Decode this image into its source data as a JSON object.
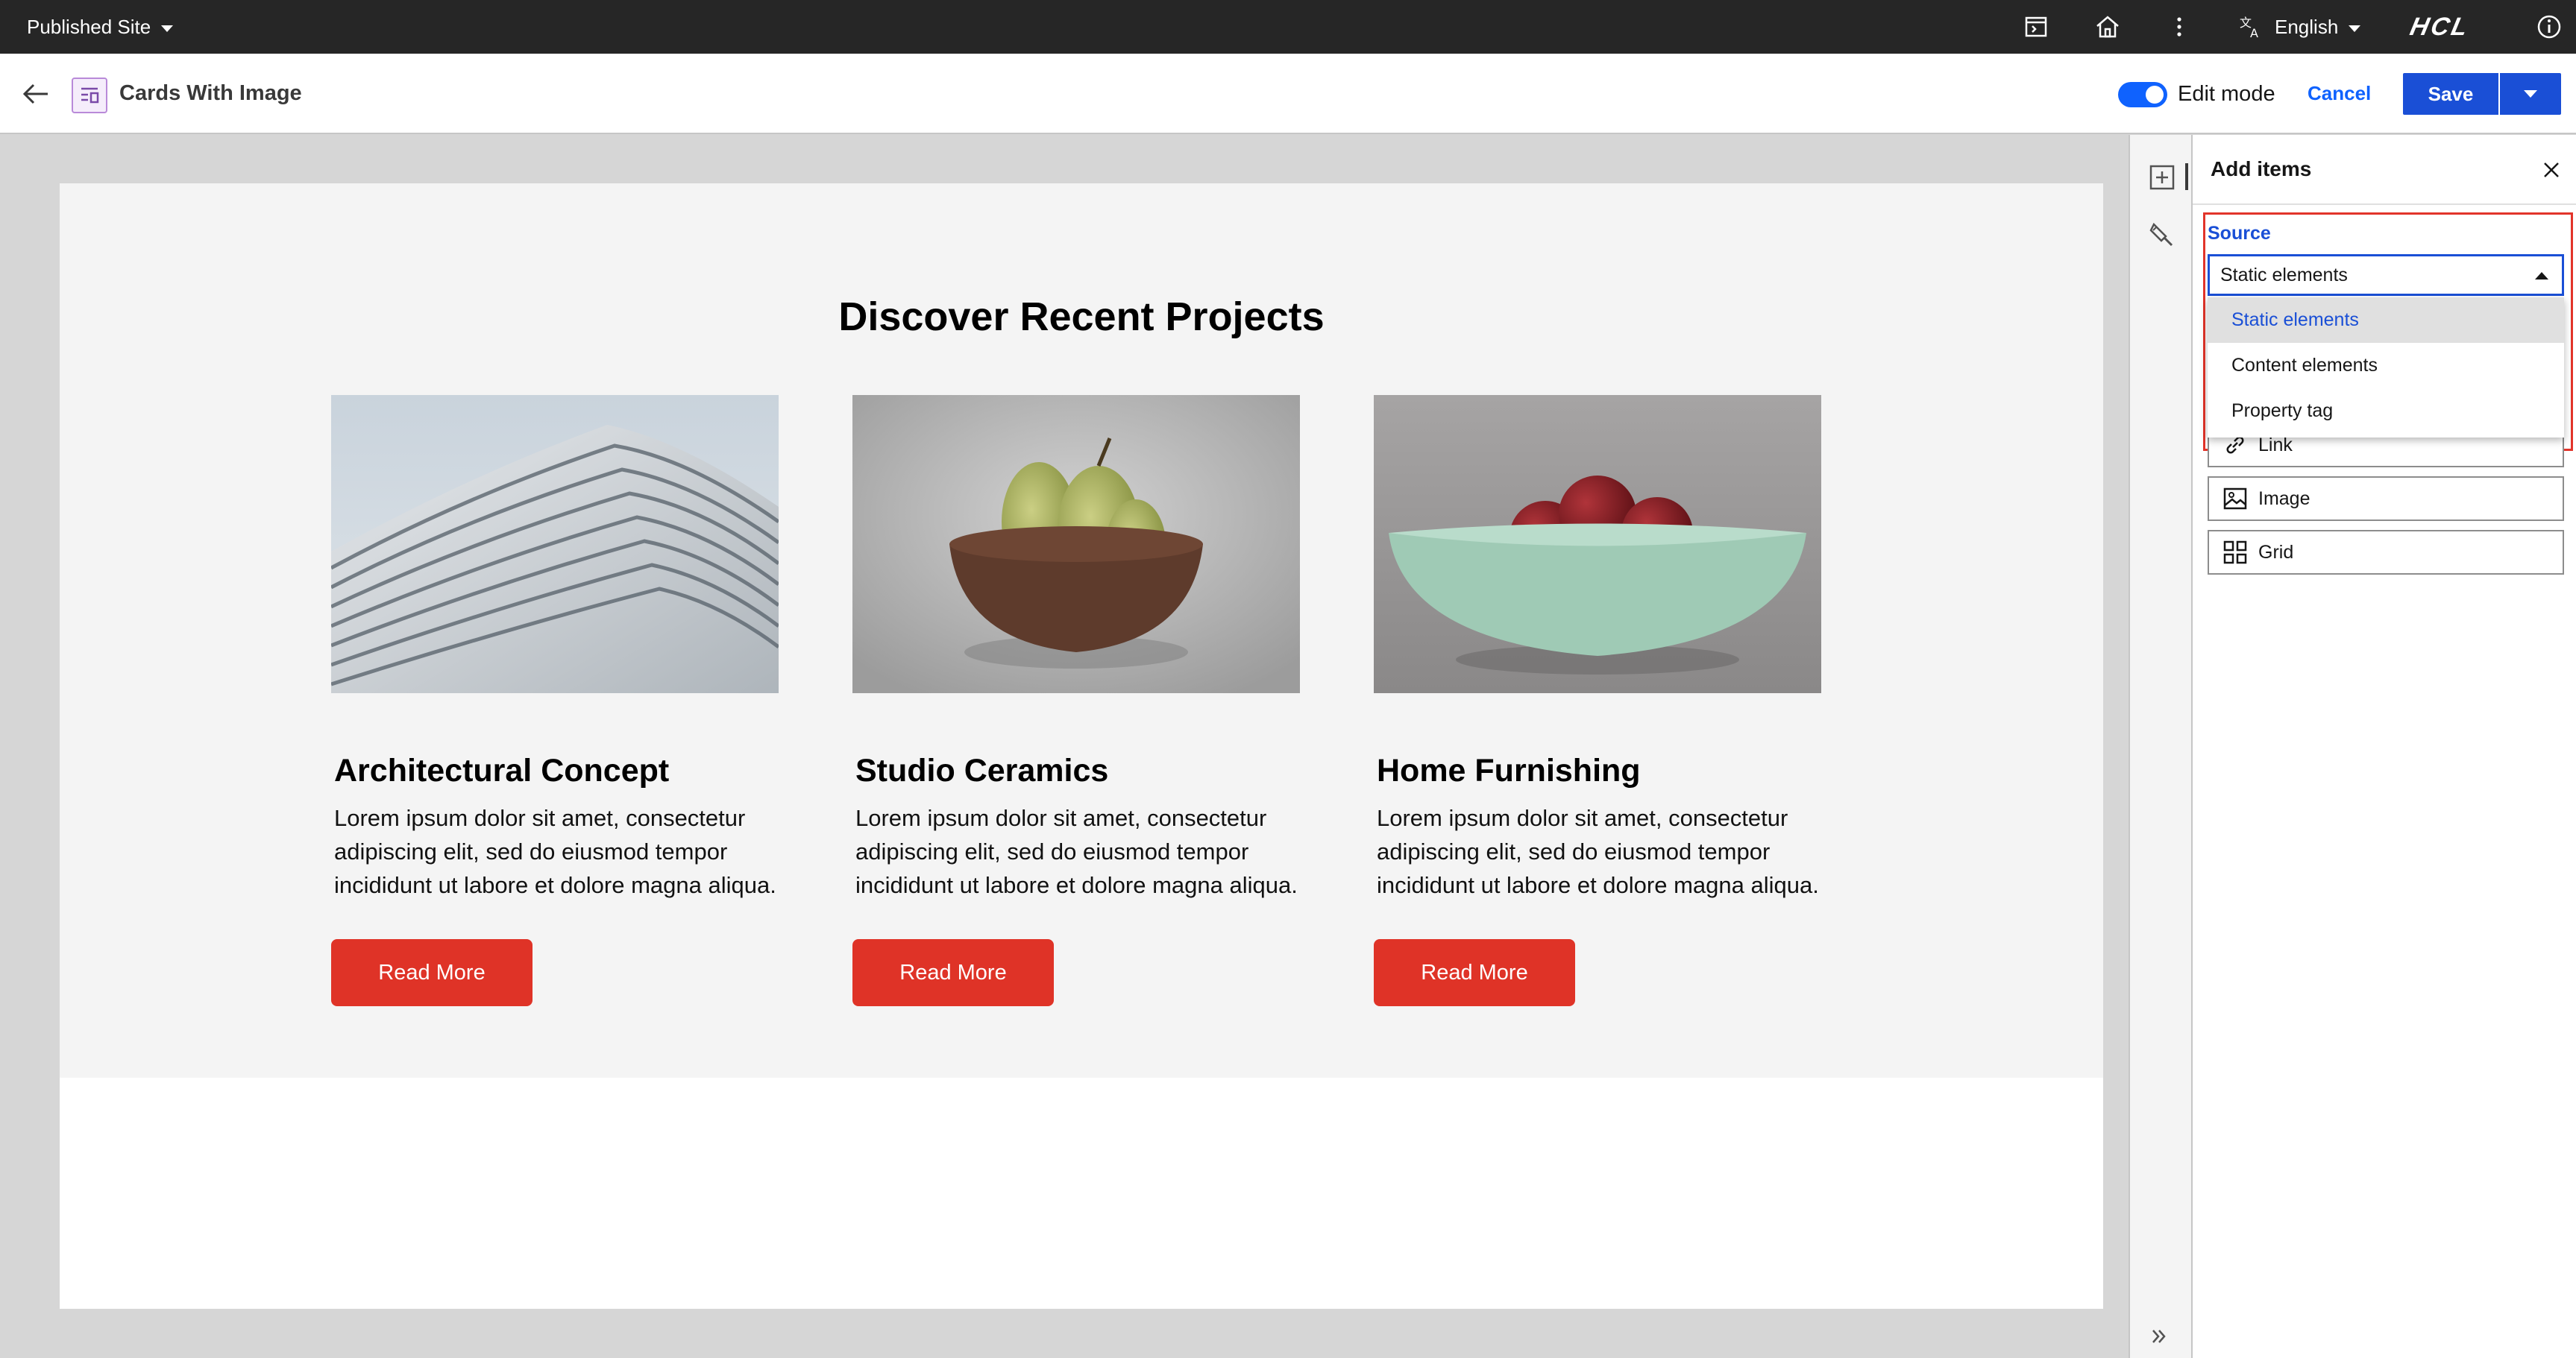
{
  "topbar": {
    "site": "Published Site",
    "language": "English",
    "brand": "HCL"
  },
  "header": {
    "page_title": "Cards With Image",
    "edit_mode_label": "Edit mode",
    "edit_mode_on": true,
    "cancel_label": "Cancel",
    "save_label": "Save"
  },
  "canvas": {
    "heading": "Discover Recent Projects",
    "cards": [
      {
        "title": "Architectural Concept",
        "text": "Lorem ipsum dolor sit amet, consectetur adipiscing elit, sed do eiusmod tempor incididunt ut labore et dolore magna aliqua.",
        "button": "Read More"
      },
      {
        "title": "Studio Ceramics",
        "text": "Lorem ipsum dolor sit amet, consectetur adipiscing elit, sed do eiusmod tempor incididunt ut labore et dolore magna aliqua.",
        "button": "Read More"
      },
      {
        "title": "Home Furnishing",
        "text": "Lorem ipsum dolor sit amet, consectetur adipiscing elit, sed do eiusmod tempor incididunt ut labore et dolore magna aliqua.",
        "button": "Read More"
      }
    ]
  },
  "panel": {
    "title": "Add items",
    "source_label": "Source",
    "source_value": "Static elements",
    "source_options": [
      "Static elements",
      "Content elements",
      "Property tag"
    ],
    "items": [
      "Link",
      "Image",
      "Grid"
    ]
  },
  "colors": {
    "accent": "#1a4fd6",
    "button_red": "#df3327",
    "highlight_red": "#e2342a",
    "topbar": "#262626"
  }
}
